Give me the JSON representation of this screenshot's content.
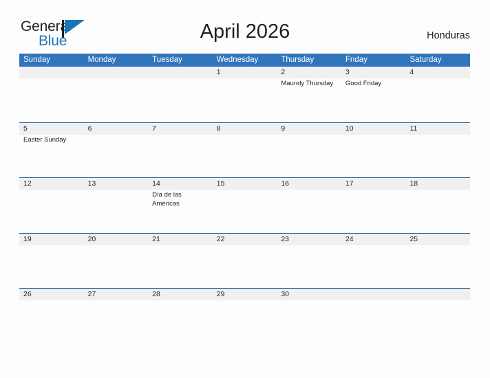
{
  "brand": {
    "word_one": "General",
    "word_two": "Blue",
    "flag_icon": "flag-triangle-icon",
    "accent_color": "#1b75bb"
  },
  "header": {
    "title": "April 2026",
    "country": "Honduras"
  },
  "theme": {
    "header_bar_color": "#3075bb",
    "row_border_color": "#1f5f9e",
    "date_band_color": "#f0f0f0",
    "page_background": "#fdfdfd",
    "text_color": "#231f20"
  },
  "calendar": {
    "weekday_headers": [
      "Sunday",
      "Monday",
      "Tuesday",
      "Wednesday",
      "Thursday",
      "Friday",
      "Saturday"
    ],
    "weeks": [
      [
        {
          "date": "",
          "events": []
        },
        {
          "date": "",
          "events": []
        },
        {
          "date": "",
          "events": []
        },
        {
          "date": "1",
          "events": []
        },
        {
          "date": "2",
          "events": [
            "Maundy Thursday"
          ]
        },
        {
          "date": "3",
          "events": [
            "Good Friday"
          ]
        },
        {
          "date": "4",
          "events": []
        }
      ],
      [
        {
          "date": "5",
          "events": [
            "Easter Sunday"
          ]
        },
        {
          "date": "6",
          "events": []
        },
        {
          "date": "7",
          "events": []
        },
        {
          "date": "8",
          "events": []
        },
        {
          "date": "9",
          "events": []
        },
        {
          "date": "10",
          "events": []
        },
        {
          "date": "11",
          "events": []
        }
      ],
      [
        {
          "date": "12",
          "events": []
        },
        {
          "date": "13",
          "events": []
        },
        {
          "date": "14",
          "events": [
            "Día de las Américas"
          ]
        },
        {
          "date": "15",
          "events": []
        },
        {
          "date": "16",
          "events": []
        },
        {
          "date": "17",
          "events": []
        },
        {
          "date": "18",
          "events": []
        }
      ],
      [
        {
          "date": "19",
          "events": []
        },
        {
          "date": "20",
          "events": []
        },
        {
          "date": "21",
          "events": []
        },
        {
          "date": "22",
          "events": []
        },
        {
          "date": "23",
          "events": []
        },
        {
          "date": "24",
          "events": []
        },
        {
          "date": "25",
          "events": []
        }
      ],
      [
        {
          "date": "26",
          "events": []
        },
        {
          "date": "27",
          "events": []
        },
        {
          "date": "28",
          "events": []
        },
        {
          "date": "29",
          "events": []
        },
        {
          "date": "30",
          "events": []
        },
        {
          "date": "",
          "events": []
        },
        {
          "date": "",
          "events": []
        }
      ]
    ]
  }
}
